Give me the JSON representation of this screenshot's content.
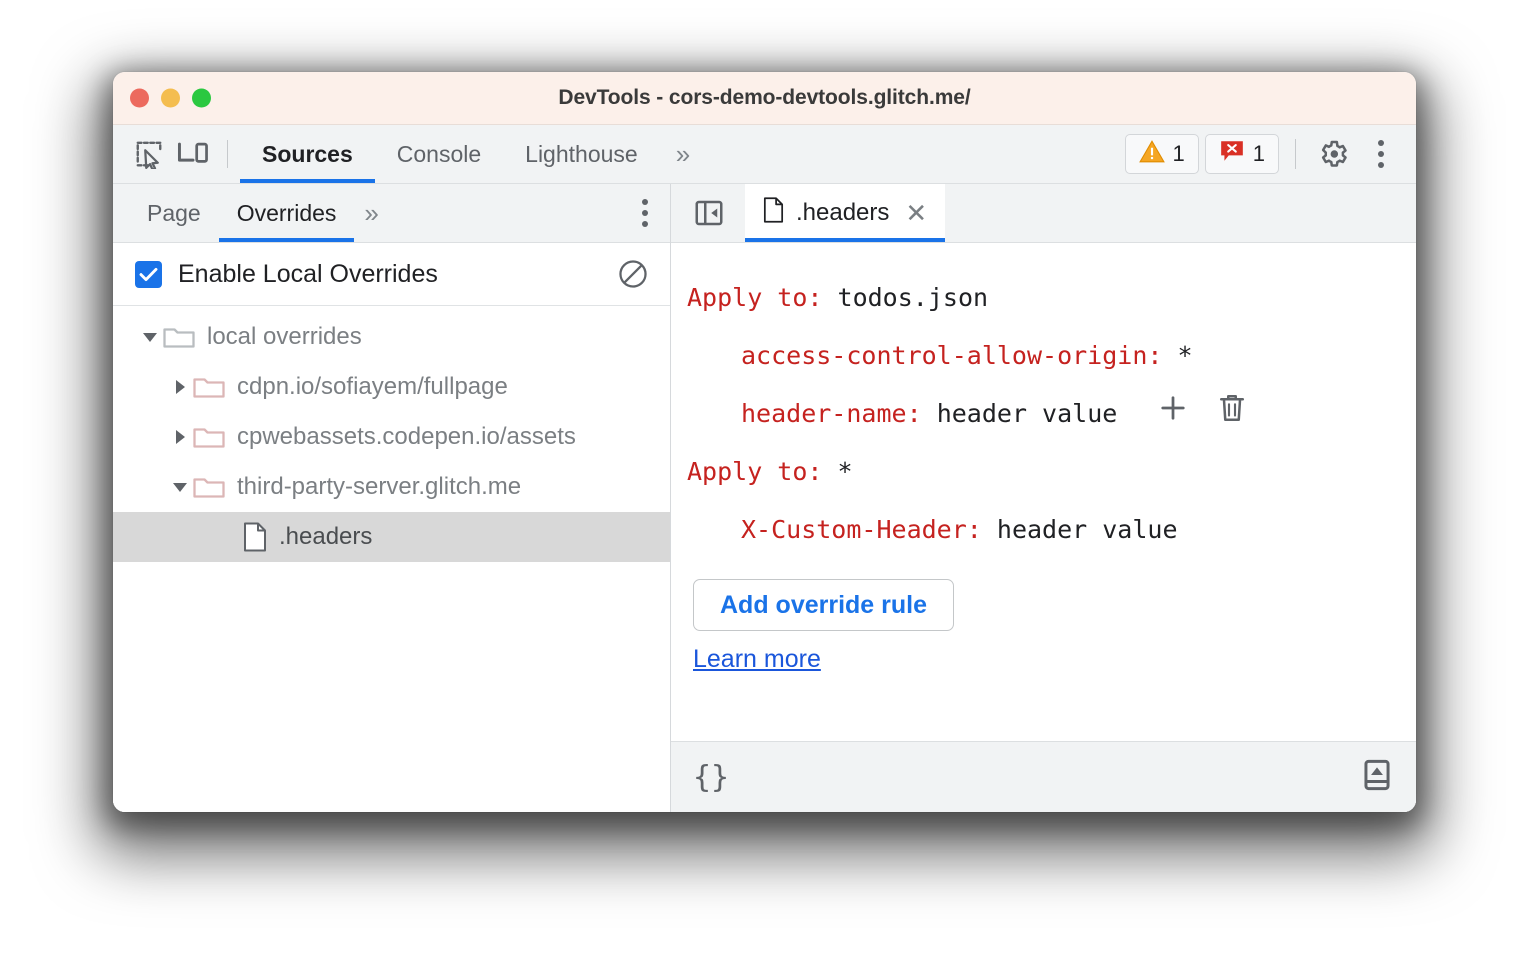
{
  "window": {
    "title": "DevTools - cors-demo-devtools.glitch.me/",
    "traffic_lights": [
      "close-red",
      "minimize-amber",
      "zoom-green"
    ]
  },
  "devtools_toolbar": {
    "icons": [
      "inspect-element-icon",
      "device-toolbar-icon"
    ],
    "tabs": [
      {
        "label": "Sources",
        "active": true
      },
      {
        "label": "Console",
        "active": false
      },
      {
        "label": "Lighthouse",
        "active": false
      }
    ],
    "more_tabs_glyph": "»",
    "warning_count": "1",
    "error_count": "1",
    "settings_icon": "gear-icon",
    "main_menu_icon": "kebab-icon"
  },
  "navigator": {
    "tabs": [
      {
        "label": "Page",
        "active": false
      },
      {
        "label": "Overrides",
        "active": true
      }
    ],
    "more_tabs_glyph": "»",
    "menu_icon": "kebab-icon",
    "enable_overrides": {
      "label": "Enable Local Overrides",
      "checked": true,
      "clear_icon": "clear-configuration-icon"
    },
    "tree": [
      {
        "label": "local overrides",
        "type": "folder",
        "depth": 0,
        "expanded": true,
        "selected": false
      },
      {
        "label": "cdpn.io/sofiayem/fullpage",
        "type": "folder",
        "depth": 1,
        "expanded": false,
        "selected": false
      },
      {
        "label": "cpwebassets.codepen.io/assets",
        "type": "folder",
        "depth": 1,
        "expanded": false,
        "selected": false
      },
      {
        "label": "third-party-server.glitch.me",
        "type": "folder",
        "depth": 1,
        "expanded": true,
        "selected": false
      },
      {
        "label": ".headers",
        "type": "file",
        "depth": 2,
        "expanded": null,
        "selected": true
      }
    ]
  },
  "editor": {
    "collapse_icon": "collapse-sidebar-icon",
    "tab": {
      "label": ".headers",
      "icon": "file-icon",
      "close_glyph": "✕"
    },
    "rules": [
      {
        "apply_to_label": "Apply to:",
        "apply_to_value": "todos.json",
        "headers": [
          {
            "name": "access-control-allow-origin:",
            "value": "*",
            "has_actions": false
          },
          {
            "name": "header-name:",
            "value": "header value",
            "has_actions": true
          }
        ]
      },
      {
        "apply_to_label": "Apply to:",
        "apply_to_value": "*",
        "headers": [
          {
            "name": "X-Custom-Header:",
            "value": "header value",
            "has_actions": false
          }
        ]
      }
    ],
    "row_actions": {
      "add_icon": "plus-icon",
      "delete_icon": "trash-icon"
    },
    "add_rule_button": "Add override rule",
    "learn_more_link": "Learn more"
  },
  "status_bar": {
    "pretty_print_label": "{}",
    "drawer_toggle_icon": "show-drawer-icon"
  },
  "annotations": {
    "accent_color": "#1152f5",
    "targets": [
      "row-actions",
      "apply-to-wildcard",
      "add-override-rule-button"
    ]
  },
  "colors": {
    "titlebar_bg": "#fcf0ea",
    "toolbar_bg": "#f1f3f4",
    "accent_blue": "#1a73e8",
    "header_key_red": "#c5221f",
    "selected_row": "#d8d8d8",
    "link_blue": "#1a56db"
  }
}
